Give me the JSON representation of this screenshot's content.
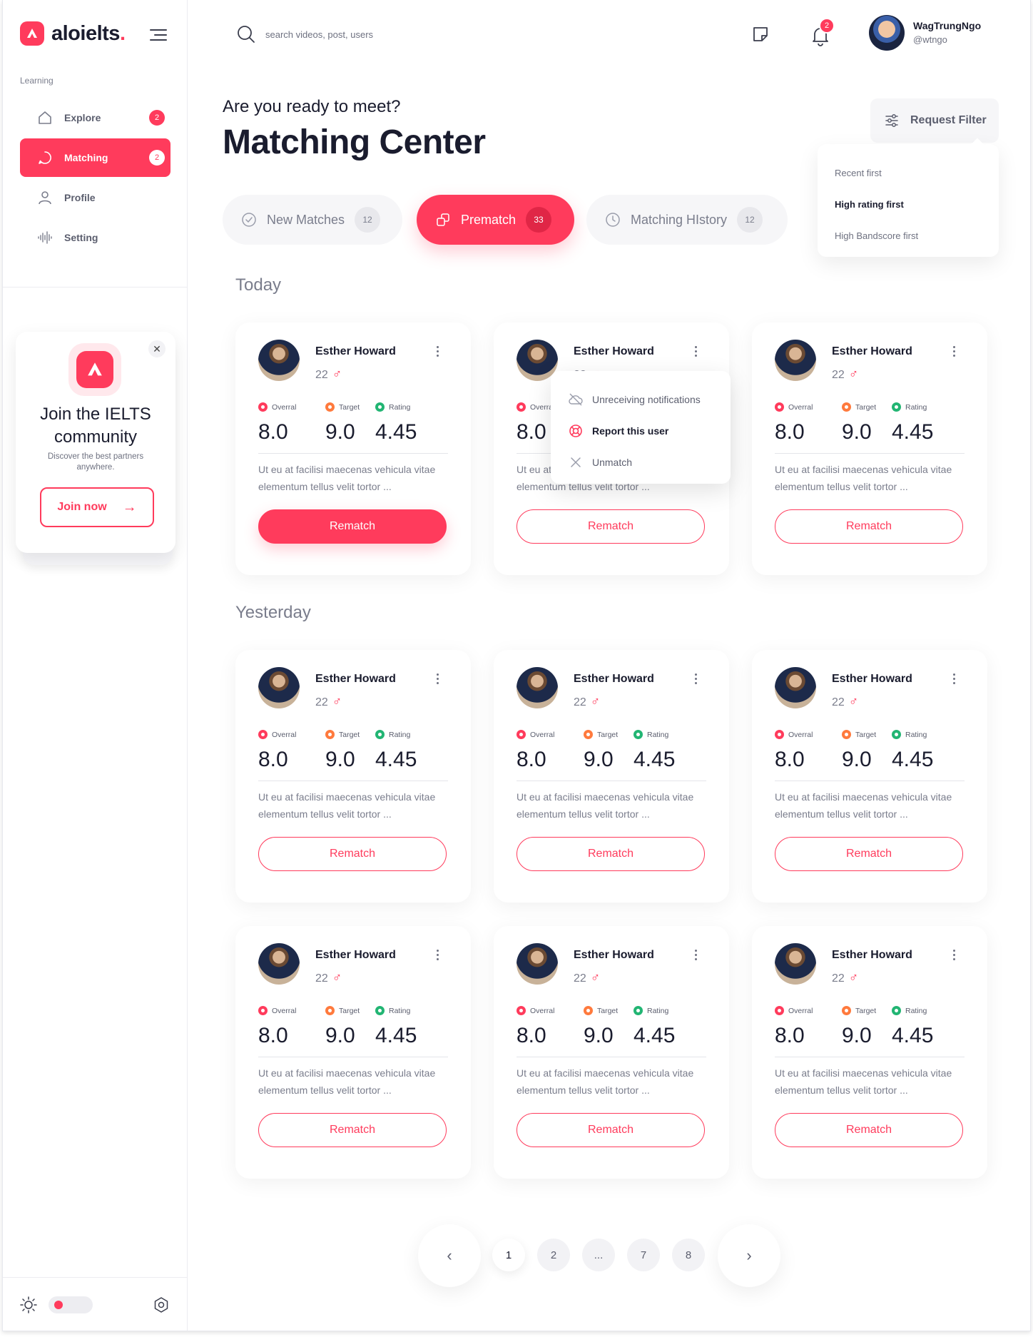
{
  "brand": {
    "name": "aloielts",
    "dot": ".",
    "accent": "#ff3b5c"
  },
  "sidebar": {
    "section_label": "Learning",
    "items": [
      {
        "label": "Explore",
        "badge": "2",
        "icon": "home-icon"
      },
      {
        "label": "Matching",
        "badge": "2",
        "icon": "chat-bubble-icon",
        "active": true
      },
      {
        "label": "Profile",
        "icon": "user-icon"
      },
      {
        "label": "Setting",
        "icon": "sound-wave-icon"
      }
    ],
    "promo": {
      "title": "Join the IELTS community",
      "subtitle": "Discover the best partners anywhere.",
      "button": "Join now"
    }
  },
  "header": {
    "search_placeholder": "search videos, post, users",
    "notifications": "2",
    "user": {
      "name": "WagTrungNgo",
      "handle": "@wtngo"
    }
  },
  "page": {
    "subtitle": "Are you ready to meet?",
    "title": "Matching Center"
  },
  "filter": {
    "label": "Request Filter",
    "options": [
      "Recent first",
      "High rating first",
      "High Bandscore first"
    ],
    "selected": "High rating first"
  },
  "tabs": [
    {
      "label": "New Matches",
      "count": "12"
    },
    {
      "label": "Prematch",
      "count": "33",
      "active": true
    },
    {
      "label": "Matching HIstory",
      "count": "12"
    }
  ],
  "groups": [
    {
      "label": "Today"
    },
    {
      "label": "Yesterday"
    }
  ],
  "card_template": {
    "name": "Esther Howard",
    "age": "22",
    "gender_symbol": "♂",
    "stats": [
      {
        "label": "Overral",
        "value": "8.0",
        "color": "#ff3b5c"
      },
      {
        "label": "Target",
        "value": "9.0",
        "color": "#ff7a3d"
      },
      {
        "label": "Rating",
        "value": "4.45",
        "color": "#22b573"
      }
    ],
    "description": "Ut eu at facilisi maecenas vehicula vitae elementum tellus velit tortor ...",
    "button": "Rematch"
  },
  "context_menu": {
    "items": [
      "Unreceiving notifications",
      "Report this user",
      "Unmatch"
    ]
  },
  "pagination": {
    "pages": [
      "1",
      "2",
      "...",
      "7",
      "8"
    ],
    "current": "1"
  }
}
